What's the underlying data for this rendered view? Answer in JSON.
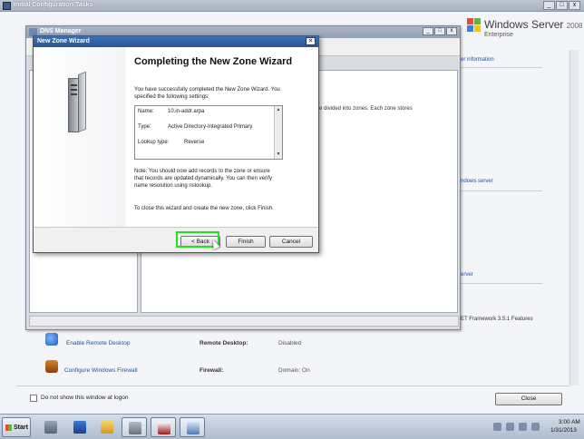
{
  "ict": {
    "title": "Initial Configuration Tasks",
    "logo": {
      "brand": "Windows Server",
      "version": "2008 R2",
      "edition": "Enterprise"
    },
    "right_pane": {
      "link_info": "er information",
      "text_zones": "e divided into zones. Each zone stores",
      "link_windows_server": "ndows server",
      "link_server": "erver",
      "text_framework": "ET Framework 3.5.1 Features"
    },
    "tasks": [
      {
        "link": "Enable Remote Desktop",
        "label": "Remote Desktop:",
        "value": "Disabled"
      },
      {
        "link": "Configure Windows Firewall",
        "label": "Firewall:",
        "value": "Domain: On"
      }
    ],
    "checkbox_label": "Do not show this window at logon",
    "close_label": "Close"
  },
  "dns": {
    "title": "DNS Manager",
    "body_text": "e divided into zones. Each zone stores"
  },
  "wizard": {
    "title": "New Zone Wizard",
    "heading": "Completing the New Zone Wizard",
    "intro_line1": "You have successfully completed the New Zone Wizard. You",
    "intro_line2": "specified the following settings:",
    "summary": [
      {
        "key": "Name:",
        "value": "10.in-addr.arpa"
      },
      {
        "key": "Type:",
        "value": "Active Directory-Integrated Primary"
      },
      {
        "key": "Lookup type:",
        "value": "Reverse"
      }
    ],
    "note_line1": "Note: You should now add records to the zone or ensure",
    "note_line2": "that records are updated dynamically. You can then verify",
    "note_line3": "name resolution using nslookup.",
    "close_hint": "To close this wizard and create the new zone, click Finish.",
    "back_label": "< Back",
    "finish_label": "Finish",
    "cancel_label": "Cancel",
    "highlight_color": "#22e022"
  },
  "taskbar": {
    "start_label": "Start",
    "time": "3:00 AM",
    "date": "1/31/2013"
  }
}
